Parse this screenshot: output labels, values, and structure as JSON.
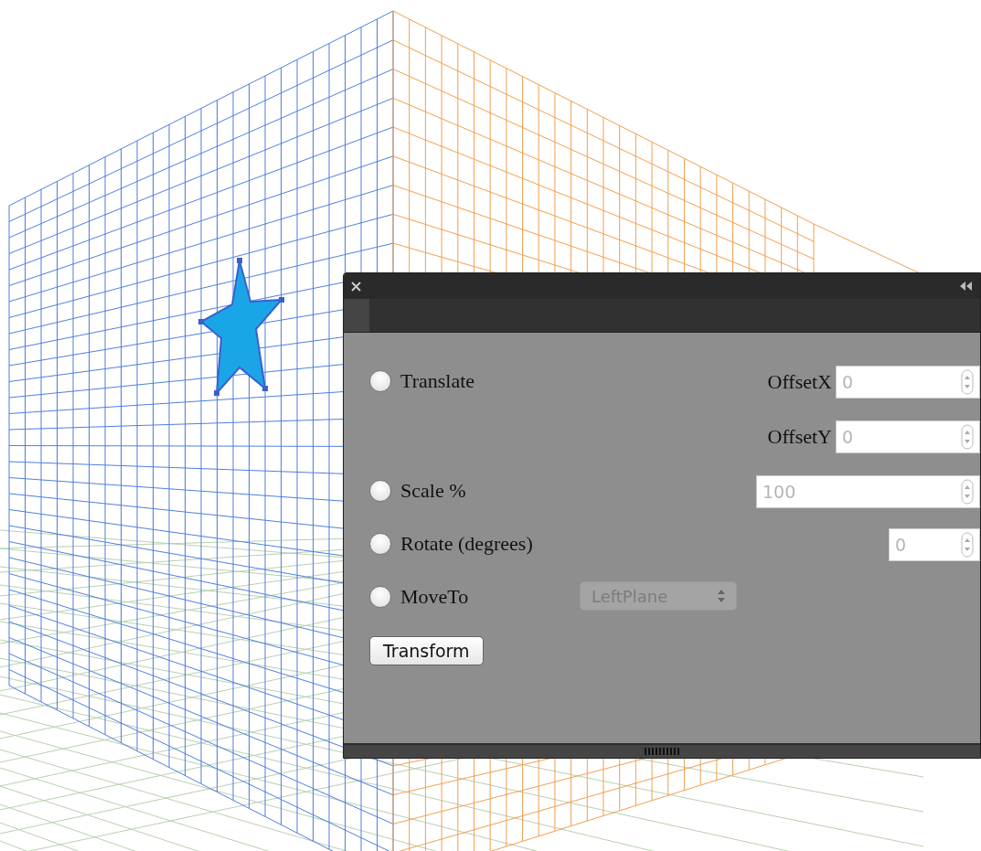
{
  "panel": {
    "options": [
      {
        "kind": "offsets",
        "label": "Translate",
        "selected": false,
        "fields": [
          {
            "label": "OffsetX",
            "value": "0"
          },
          {
            "label": "OffsetY",
            "value": "0"
          }
        ]
      },
      {
        "kind": "number",
        "label": "Scale %",
        "selected": false,
        "fields": [
          {
            "value": "100"
          }
        ]
      },
      {
        "kind": "short",
        "label": "Rotate (degrees)",
        "selected": false,
        "fields": [
          {
            "value": "0"
          }
        ]
      },
      {
        "kind": "select",
        "label": "MoveTo",
        "selected": false,
        "select": "LeftPlane"
      }
    ],
    "button": "Transform"
  }
}
